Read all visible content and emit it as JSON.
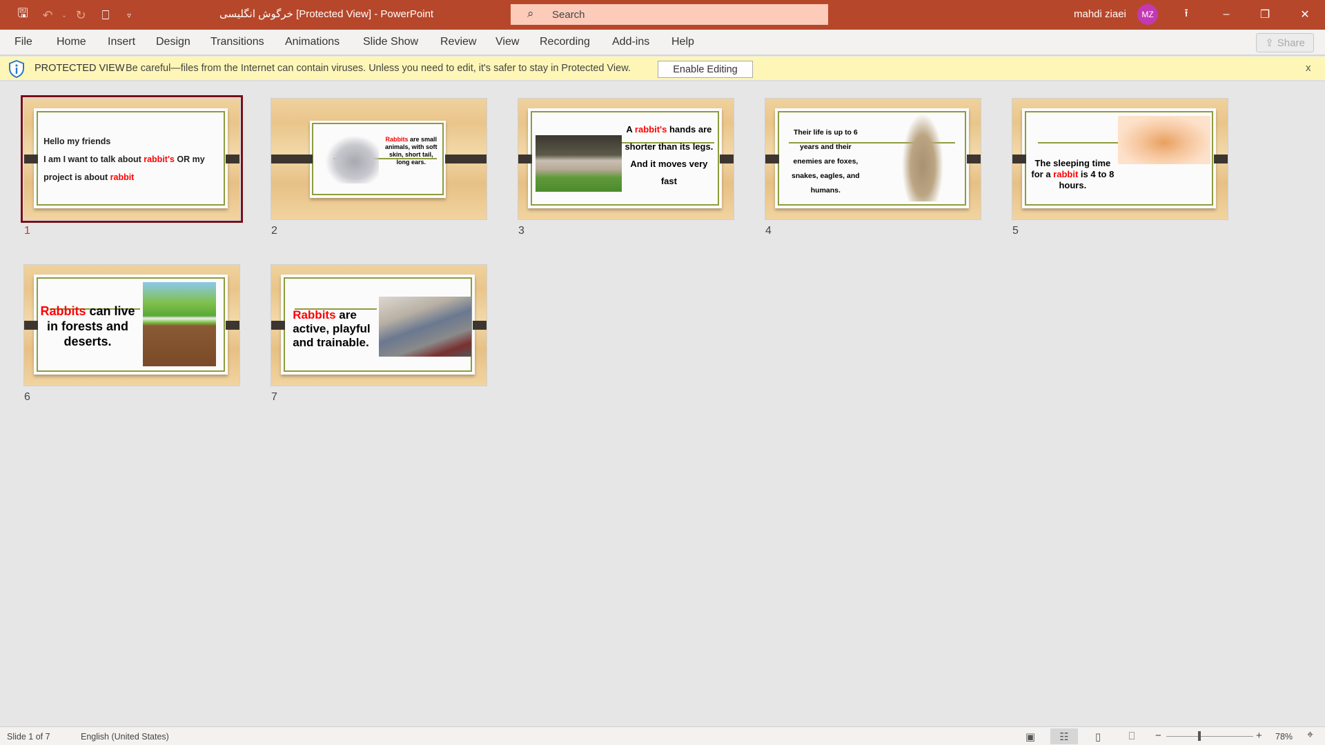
{
  "titlebar": {
    "title": "خرگوش انگلیسی [Protected View]  -  PowerPoint",
    "search_placeholder": "Search",
    "user_name": "mahdi ziaei",
    "user_initials": "MZ",
    "accent": "#b7472a"
  },
  "menu": [
    "File",
    "Home",
    "Insert",
    "Design",
    "Transitions",
    "Animations",
    "Slide Show",
    "Review",
    "View",
    "Recording",
    "Add-ins",
    "Help"
  ],
  "share_label": "Share",
  "protected_view": {
    "label": "PROTECTED VIEW",
    "message": "Be careful—files from the Internet can contain viruses. Unless you need to edit, it's safer to stay in Protected View.",
    "button": "Enable Editing",
    "close": "x"
  },
  "slides": [
    {
      "number": "1",
      "selected": true,
      "line1": "Hello my friends",
      "line2a": "I am  I want to talk about ",
      "line2b": "rabbit's",
      "line2c": " OR my",
      "line3a": "project is about ",
      "line3b": "rabbit"
    },
    {
      "number": "2",
      "t_red": "Rabbits",
      "t_rest": " are small animals, with soft skin, short tail, long ears.",
      "image": "grey-white-rabbit"
    },
    {
      "number": "3",
      "t_a": "A ",
      "t_red": "rabbit's",
      "t_rest": " hands are shorter than its legs. And it moves very fast",
      "image": "lop-rabbit-on-grass"
    },
    {
      "number": "4",
      "t_rest": "Their life is up to 6 years and their enemies are foxes, snakes, eagles, and humans.",
      "image": "standing-brown-rabbit"
    },
    {
      "number": "5",
      "t_a": "The sleeping time for a ",
      "t_red": "rabbit",
      "t_rest": " is 4 to 8 hours.",
      "image": "sleeping-rabbit-illustration"
    },
    {
      "number": "6",
      "t_red": "Rabbits",
      "t_rest": " can live in forests and deserts.",
      "image": "rabbit-burrow-illustration"
    },
    {
      "number": "7",
      "t_red": "Rabbits",
      "t_rest": " are active, playful and trainable.",
      "image": "two-rabbits-on-sofa"
    }
  ],
  "status": {
    "slide": "Slide 1 of 7",
    "language": "English (United States)",
    "zoom": "78%",
    "zoom_percent": 78
  }
}
